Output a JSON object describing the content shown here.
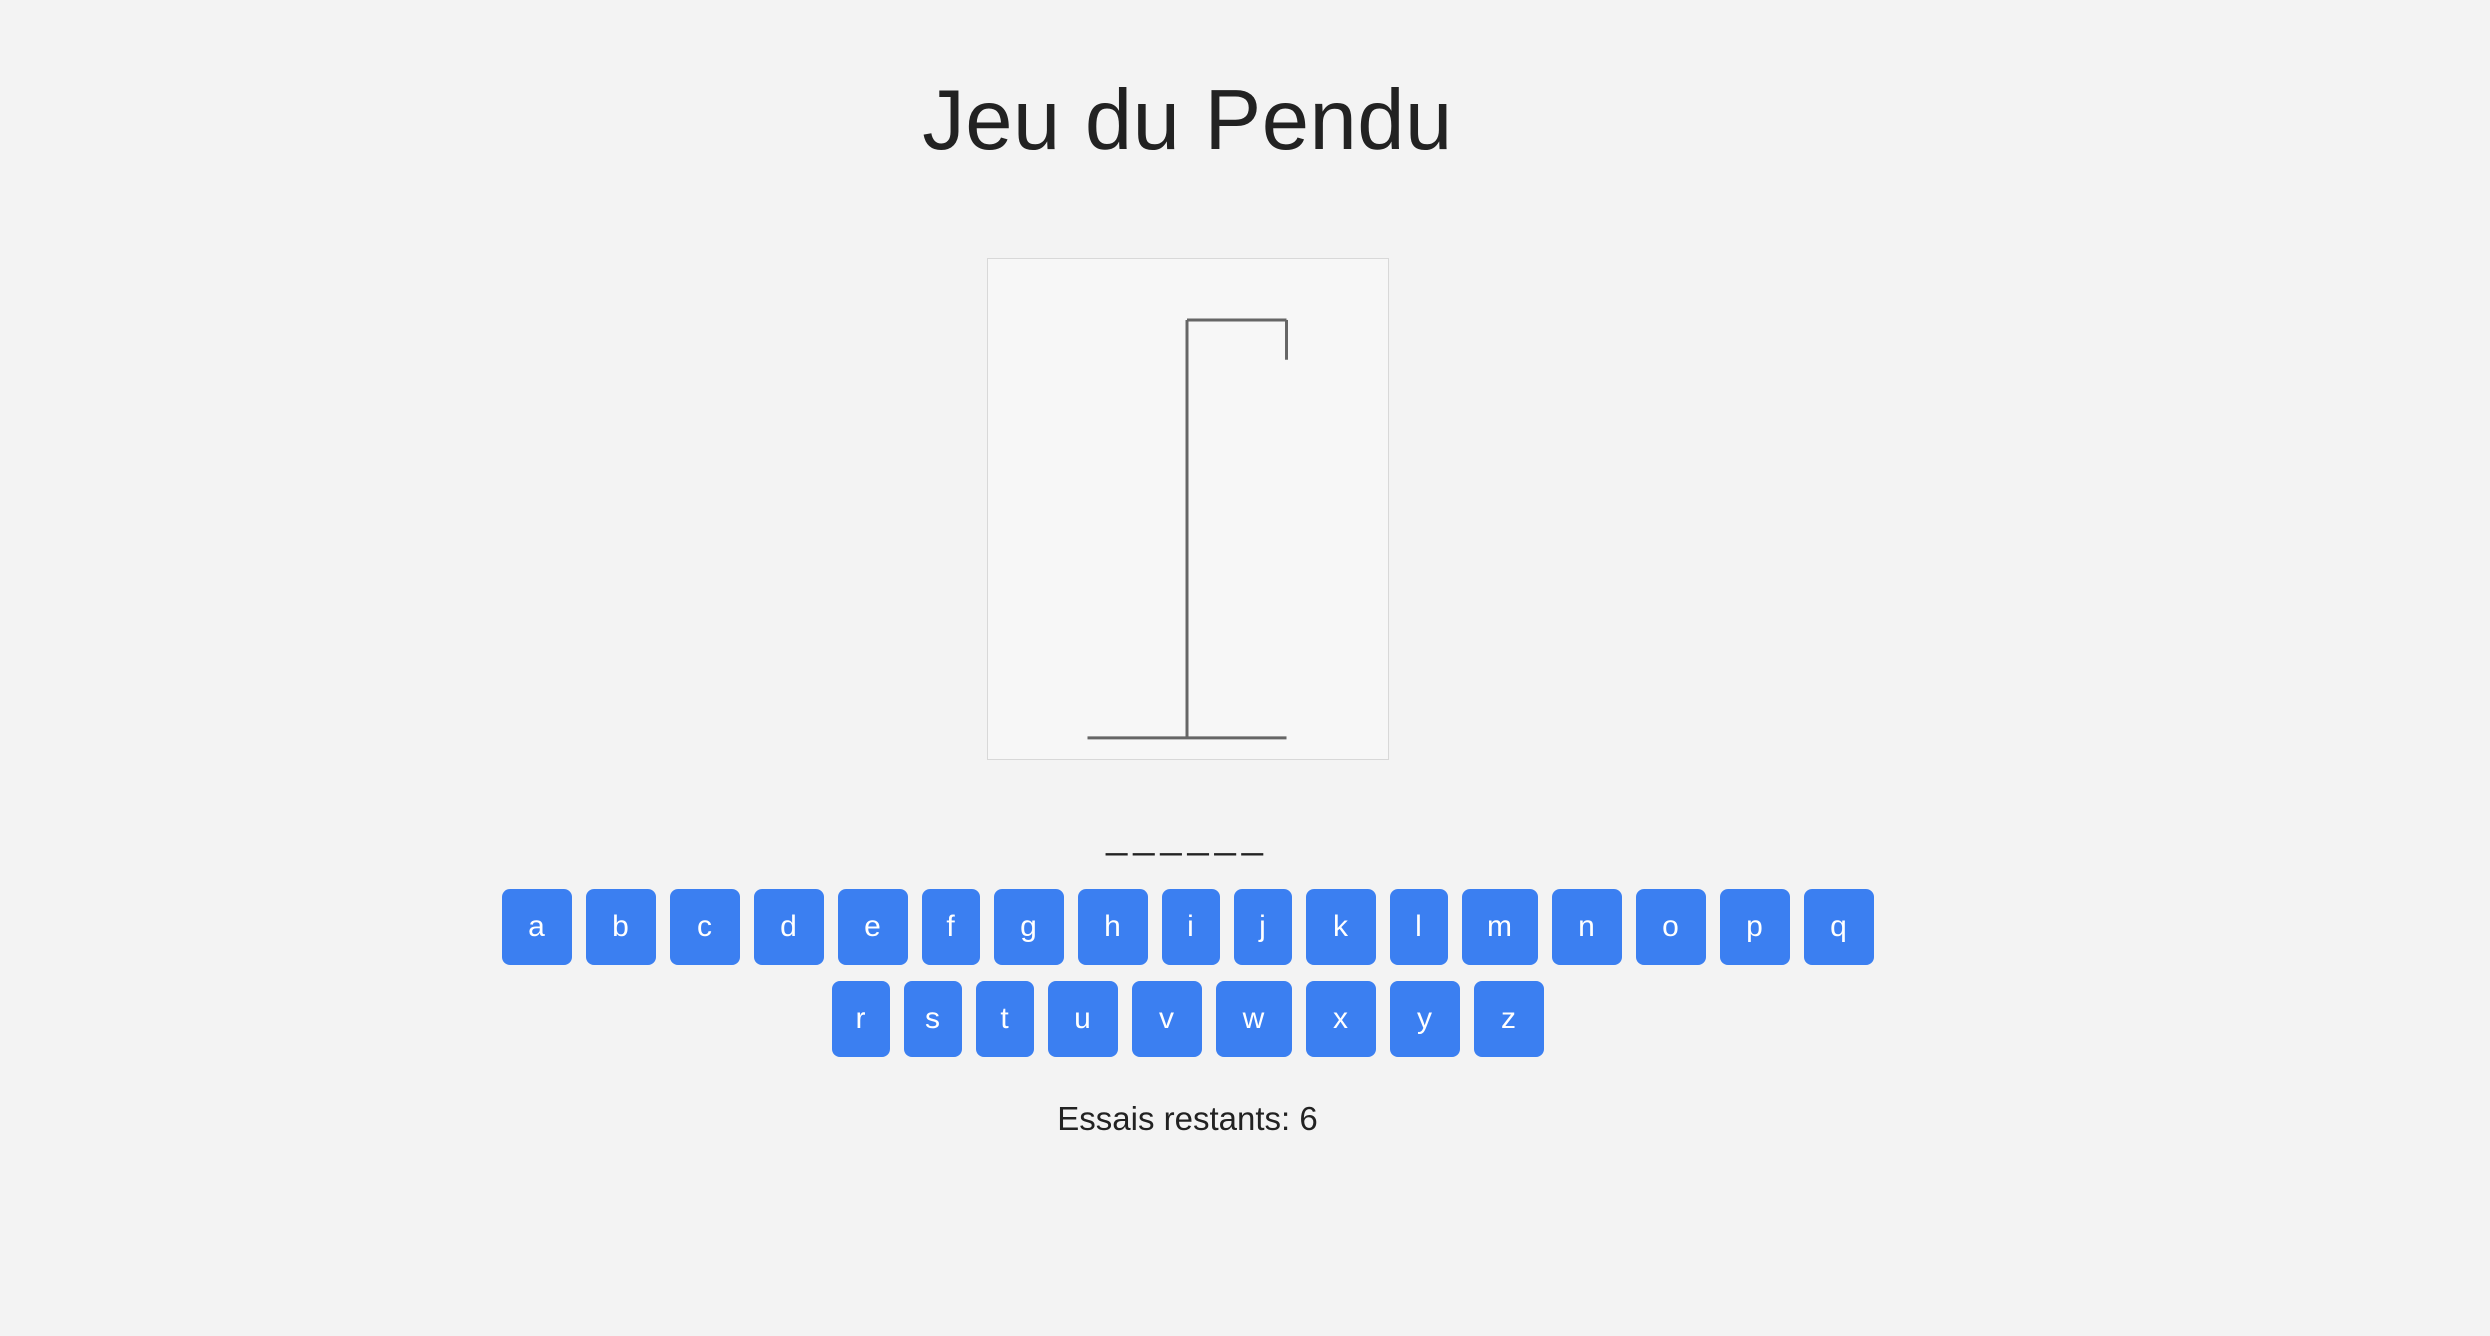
{
  "title": "Jeu du Pendu",
  "word_display": "______",
  "keyboard": {
    "row1": [
      "a",
      "b",
      "c",
      "d",
      "e",
      "f",
      "g",
      "h",
      "i",
      "j",
      "k",
      "l",
      "m",
      "n",
      "o",
      "p",
      "q"
    ],
    "row2": [
      "r",
      "s",
      "t",
      "u",
      "v",
      "w",
      "x",
      "y",
      "z"
    ]
  },
  "status": {
    "label": "Essais restants: 6",
    "remaining_tries": 6
  },
  "colors": {
    "key_bg": "#3b7ff1",
    "background": "#f3f3f3",
    "gallows": "#666666"
  }
}
